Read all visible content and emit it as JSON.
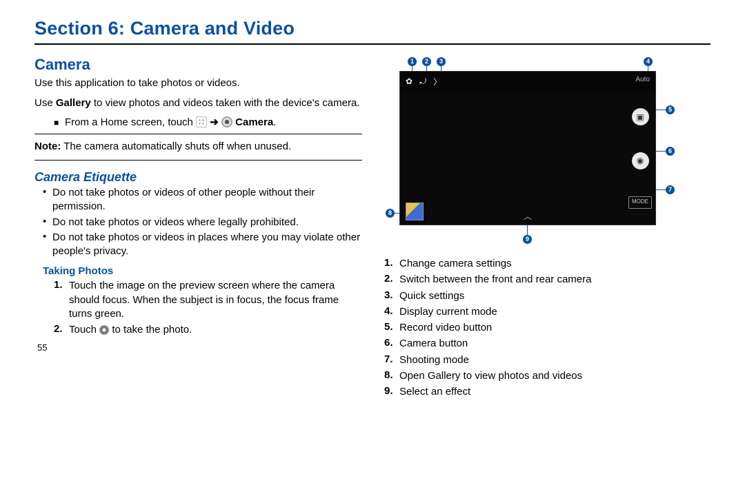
{
  "section_title": "Section 6: Camera and Video",
  "page_number": "55",
  "left": {
    "h2": "Camera",
    "intro": "Use this application to take photos or videos.",
    "gallery_prefix": "Use ",
    "gallery_bold": "Gallery",
    "gallery_suffix": " to view photos and videos taken with the device's camera.",
    "step_prefix": "From a Home screen, touch ",
    "step_arrow": "➔",
    "step_camera_label": " Camera",
    "step_period": ".",
    "note_bold": "Note:",
    "note_body": " The camera automatically shuts off when unused.",
    "etiquette_h": "Camera Etiquette",
    "etiquette": [
      "Do not take photos or videos of other people without their permission.",
      "Do not take photos or videos where legally prohibited.",
      "Do not take photos or videos in places where you may violate other people's privacy."
    ],
    "taking_h": "Taking Photos",
    "taking_steps": [
      "Touch the image on the preview screen where the camera should focus. When the subject is in focus, the focus frame turns green.",
      "Touch  to take the photo."
    ]
  },
  "right": {
    "auto_label": "Auto",
    "mode_label": "MODE",
    "legend": [
      "Change camera settings",
      "Switch between the front and rear camera",
      "Quick settings",
      "Display current mode",
      "Record video button",
      "Camera button",
      "Shooting mode",
      "Open Gallery to view photos and videos",
      "Select an effect"
    ]
  }
}
